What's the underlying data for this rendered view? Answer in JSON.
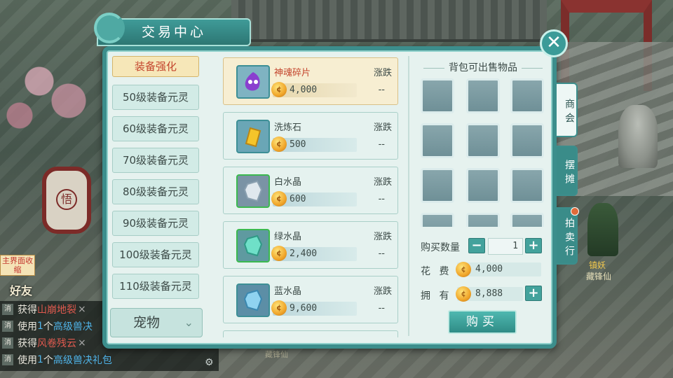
{
  "window": {
    "title": "交易中心"
  },
  "categories": {
    "items": [
      {
        "label": "装备强化",
        "active": true
      },
      {
        "label": "50级装备元灵"
      },
      {
        "label": "60级装备元灵"
      },
      {
        "label": "70级装备元灵"
      },
      {
        "label": "80级装备元灵"
      },
      {
        "label": "90级装备元灵"
      },
      {
        "label": "100级装备元灵"
      },
      {
        "label": "110级装备元灵"
      }
    ],
    "dropdown": {
      "value": "宠物",
      "icon": "chevron-down-icon"
    }
  },
  "items": [
    {
      "name": "神魂碎片",
      "price": "4,000",
      "trend_label": "涨跌",
      "trend": "--",
      "icon": "soul-fragment-icon",
      "selected": true
    },
    {
      "name": "洗炼石",
      "price": "500",
      "trend_label": "涨跌",
      "trend": "--",
      "icon": "refine-stone-icon"
    },
    {
      "name": "白水晶",
      "price": "600",
      "trend_label": "涨跌",
      "trend": "--",
      "icon": "white-crystal-icon"
    },
    {
      "name": "绿水晶",
      "price": "2,400",
      "trend_label": "涨跌",
      "trend": "--",
      "icon": "green-crystal-icon"
    },
    {
      "name": "蓝水晶",
      "price": "9,600",
      "trend_label": "涨跌",
      "trend": "--",
      "icon": "blue-crystal-icon"
    }
  ],
  "inventory": {
    "title": "背包可出售物品"
  },
  "purchase": {
    "qty_label": "购买数量",
    "qty_value": "1",
    "cost_label": "花  费",
    "cost_value": "4,000",
    "own_label": "拥  有",
    "own_value": "8,888",
    "buy_label": "购买"
  },
  "side_tabs": [
    "商会",
    "摆摊",
    "拍卖行"
  ],
  "hud": {
    "collapse_label": "主界面收缩",
    "friends_label": "好友",
    "npc_title": "镇妖",
    "npc_name": "藏锋仙",
    "ground_label": "藏锋仙"
  },
  "chat": [
    {
      "channel": "消",
      "prefix": "获得",
      "highlight": "山崩地裂",
      "suffix": "×"
    },
    {
      "channel": "消",
      "prefix": "使用",
      "count": "1",
      "unit": "个",
      "highlight": "高级兽决",
      "suffix": ""
    },
    {
      "channel": "消",
      "prefix": "获得",
      "highlight": "风卷残云",
      "suffix": "×"
    },
    {
      "channel": "消",
      "prefix": "使用",
      "count": "1",
      "unit": "个",
      "highlight": "高级兽决礼包",
      "suffix": ""
    }
  ],
  "colors": {
    "panel_border": "#3c8e8c",
    "accent_red": "#c4462e",
    "coin_gold": "#f0a52a"
  }
}
